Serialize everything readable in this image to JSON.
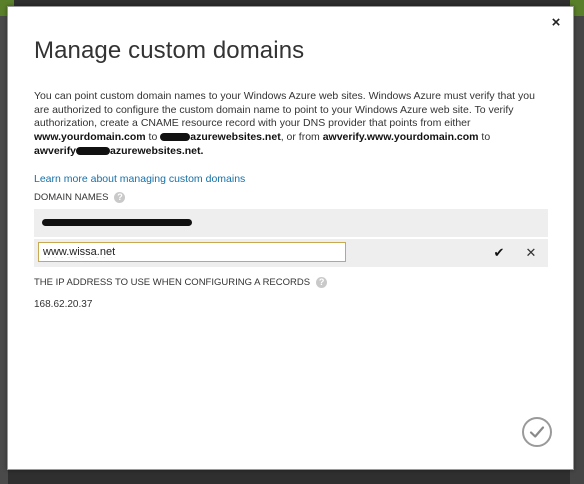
{
  "dialog": {
    "title": "Manage custom domains",
    "close_label": "×",
    "description": {
      "line1": "You can point custom domain names to your Windows Azure web sites. Windows Azure must verify that you are authorized to configure the custom domain name to point to your Windows Azure web site. To verify authorization, create a CNAME resource record with your DNS provider that points from either",
      "domain_bold": "www.yourdomain.com",
      "to_text": " to",
      "target_suffix": "azurewebsites.net",
      "or_from": ", or from ",
      "verify_bold": "awverify.www.yourdomain.com",
      "to_text2": " to",
      "verify_prefix": "awverify",
      "verify_suffix": "azurewebsites.net."
    },
    "learn_link": "Learn more about managing custom domains",
    "domain_names_label": "DOMAIN NAMES",
    "help_glyph": "?",
    "new_domain_value": "www.wissa.net",
    "confirm_glyph": "✔",
    "cancel_glyph": "✕",
    "ip_label": "THE IP ADDRESS TO USE WHEN CONFIGURING A RECORDS",
    "ip_value": "168.62.20.37"
  },
  "icons": {
    "close": "close-icon",
    "help": "help-icon",
    "confirm": "checkmark-icon",
    "cancel": "cancel-icon",
    "ok": "checkmark-circle-icon"
  },
  "colors": {
    "link": "#1570a6",
    "input_border": "#c8a850",
    "row_bg": "#eeeeee"
  }
}
